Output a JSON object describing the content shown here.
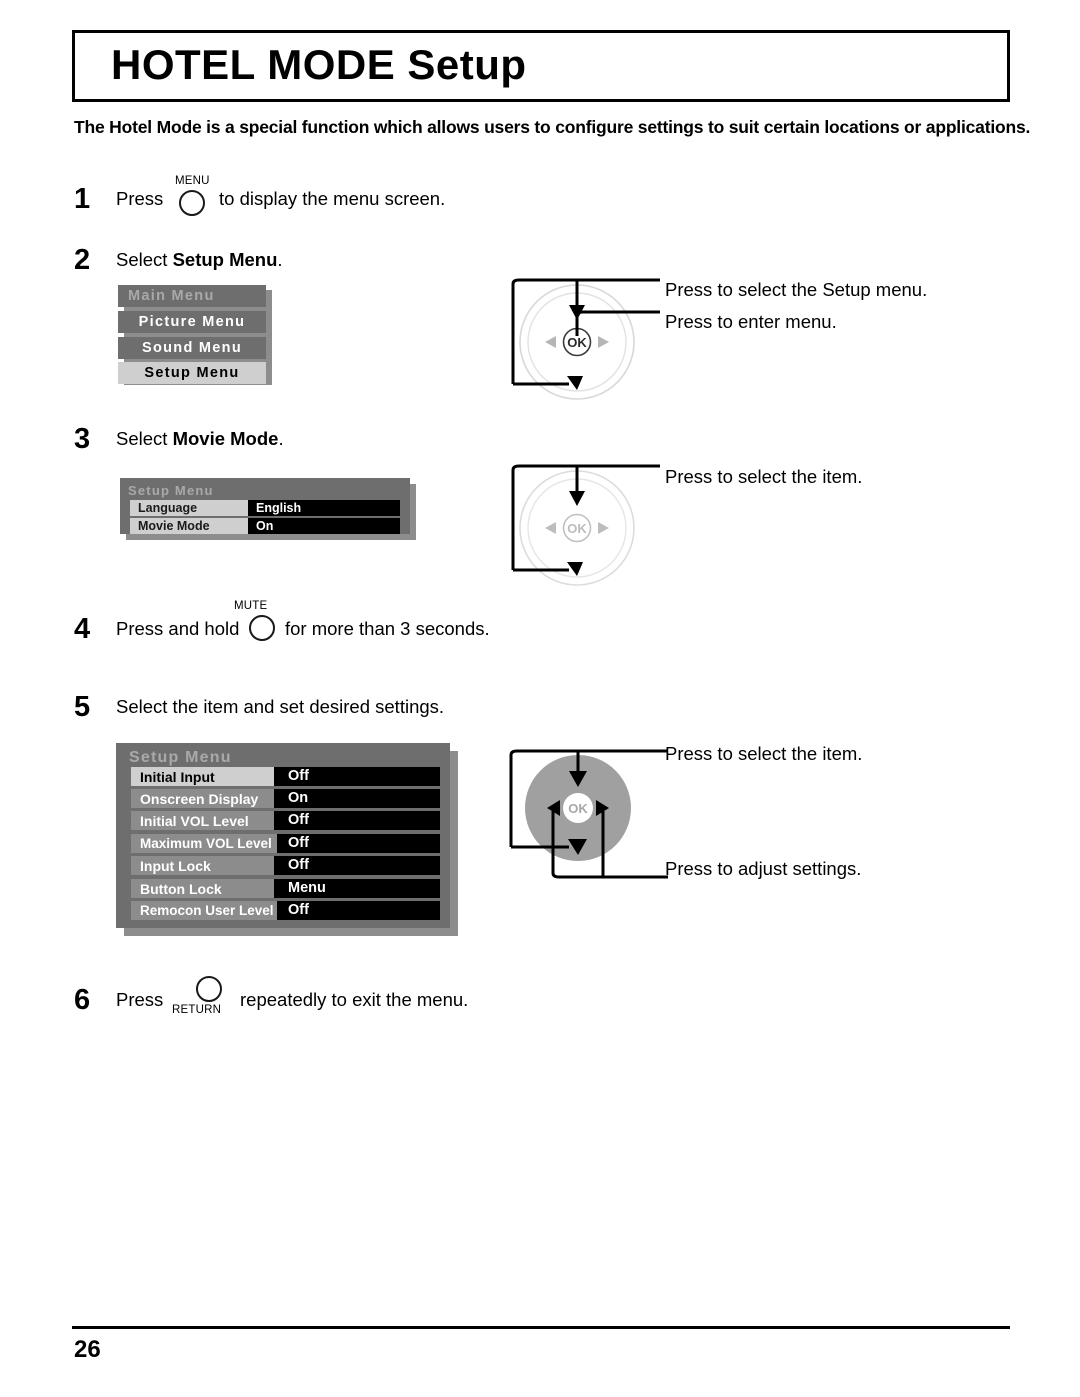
{
  "page": {
    "title": "HOTEL MODE Setup",
    "intro": "The Hotel Mode is a special function which allows users to configure settings to suit certain locations or applications.",
    "page_number": "26"
  },
  "steps": {
    "step1": {
      "number": "1",
      "text_before": "Press",
      "button_label": "MENU",
      "text_after": "to display the menu screen."
    },
    "step2": {
      "number": "2",
      "text_plain": "Select ",
      "text_bold": "Setup Menu",
      "text_tail": ".",
      "callout_top": "Press to select the Setup menu.",
      "callout_mid": "Press to enter menu."
    },
    "step3": {
      "number": "3",
      "text_plain": "Select ",
      "text_bold": "Movie Mode",
      "text_tail": ".",
      "callout_top": "Press to select the item."
    },
    "step4": {
      "number": "4",
      "text_before": "Press and hold",
      "button_label": "MUTE",
      "text_after": "for more than 3 seconds."
    },
    "step5": {
      "number": "5",
      "text": "Select the item and set desired settings.",
      "callout_top": "Press to select the item.",
      "callout_bottom": "Press to adjust settings."
    },
    "step6": {
      "number": "6",
      "text_before": "Press",
      "button_label": "RETURN",
      "text_after": "repeatedly to exit the menu."
    }
  },
  "main_menu": {
    "title": "Main Menu",
    "items": [
      {
        "label": "Picture Menu",
        "selected": false
      },
      {
        "label": "Sound Menu",
        "selected": false
      },
      {
        "label": "Setup Menu",
        "selected": true
      }
    ]
  },
  "setup_menu_small": {
    "title": "Setup Menu",
    "rows": [
      {
        "label": "Language",
        "value": "English"
      },
      {
        "label": "Movie Mode",
        "value": "On"
      }
    ]
  },
  "setup_menu_hotel": {
    "title": "Setup Menu",
    "rows": [
      {
        "label": "Initial Input",
        "value": "Off",
        "selected": true
      },
      {
        "label": "Onscreen Display",
        "value": "On",
        "selected": false
      },
      {
        "label": "Initial VOL Level",
        "value": "Off",
        "selected": false
      },
      {
        "label": "Maximum VOL Level",
        "value": "Off",
        "selected": false
      },
      {
        "label": "Input Lock",
        "value": "Off",
        "selected": false
      },
      {
        "label": "Button Lock",
        "value": "Menu",
        "selected": false
      },
      {
        "label": "Remocon User Level",
        "value": "Off",
        "selected": false
      }
    ]
  },
  "dpad": {
    "ok_label": "OK"
  },
  "colors": {
    "osd_dark_gray": "#6e6e6e",
    "osd_mid_gray": "#808080",
    "osd_light_gray": "#cfcfcf",
    "osd_title_gray": "#a9a9a9",
    "osd_value_black": "#000000",
    "dpad_gray": "#a0a0a0"
  }
}
